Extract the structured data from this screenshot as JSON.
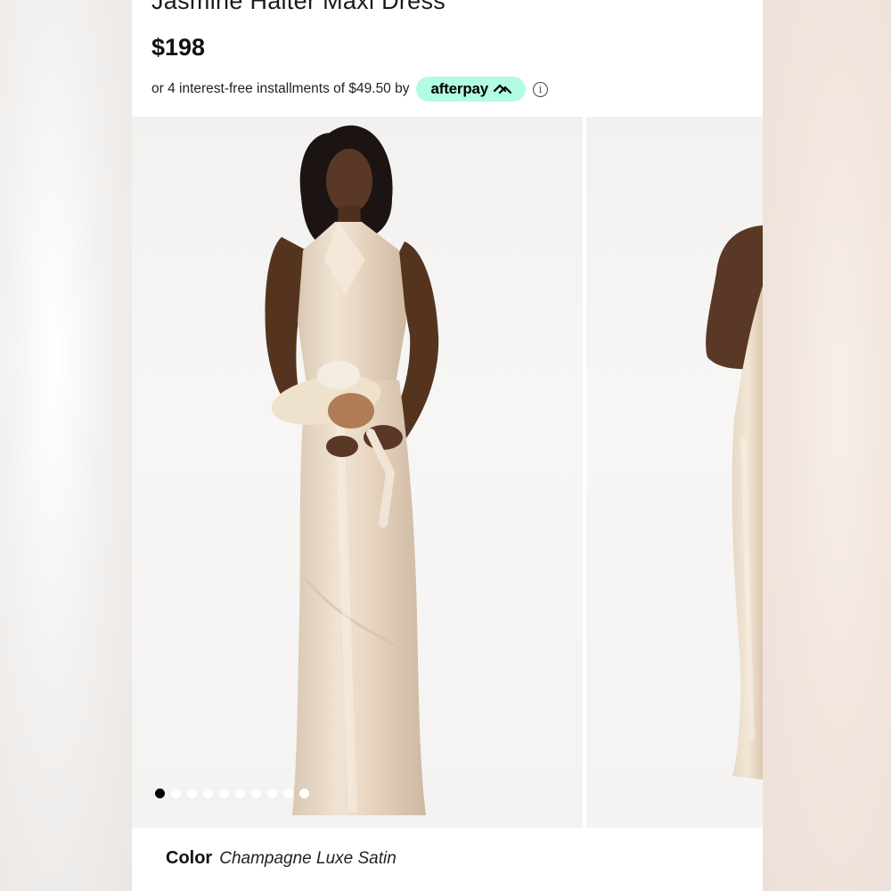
{
  "product": {
    "title": "Jasmine Halter Maxi Dress",
    "price": "$198"
  },
  "installments": {
    "text": "or 4 interest-free installments of $49.50 by",
    "provider": "afterpay",
    "badge_color": "#b2fce4"
  },
  "gallery": {
    "slides": [
      "model-front-view",
      "model-side-view"
    ],
    "dots_total": 10,
    "active_dot": 1
  },
  "color": {
    "label": "Color",
    "value": "Champagne Luxe Satin"
  },
  "colors": {
    "dress": "#e9d9c6",
    "skin": "#5a3826",
    "hair": "#1c1412"
  }
}
